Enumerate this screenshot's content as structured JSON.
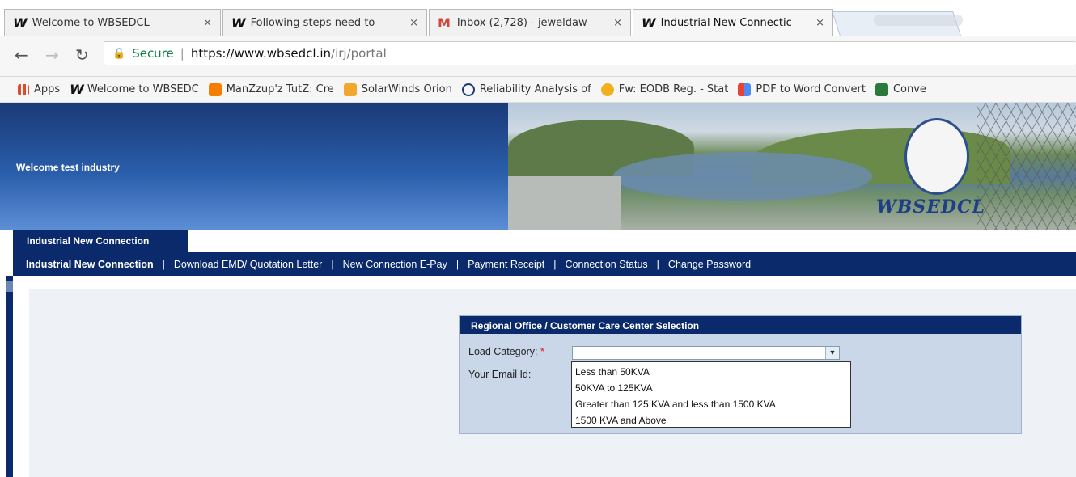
{
  "browser": {
    "tabs": [
      {
        "title": "Welcome to WBSEDCL",
        "icon": "wbsedcl-logo-icon"
      },
      {
        "title": "Following steps need to",
        "icon": "wbsedcl-logo-icon"
      },
      {
        "title": "Inbox (2,728) - jeweldaw",
        "icon": "gmail-icon"
      },
      {
        "title": "Industrial New Connectic",
        "icon": "wbsedcl-logo-icon"
      }
    ],
    "close_glyph": "×",
    "secure_label": "Secure",
    "url_host": "https://www.wbsedcl.in",
    "url_path": "/irj/portal",
    "bookmarks": [
      {
        "label": "Apps",
        "icon": "apps-grid-icon",
        "color": "#e04b2f"
      },
      {
        "label": "Welcome to WBSEDC",
        "icon": "wbsedcl-logo-icon",
        "color": "#111111"
      },
      {
        "label": "ManZzup'z TutZ: Cre",
        "icon": "blogger-icon",
        "color": "#f57d00"
      },
      {
        "label": "SolarWinds Orion",
        "icon": "solarwinds-icon",
        "color": "#f0a830"
      },
      {
        "label": "Reliability Analysis of",
        "icon": "scribd-icon",
        "color": "#1a3b78"
      },
      {
        "label": "Fw: EODB Reg. - Stat",
        "icon": "mail-icon",
        "color": "#f2b01e"
      },
      {
        "label": "PDF to Word Convert",
        "icon": "pdf-icon",
        "color": "#4c8bf5"
      },
      {
        "label": "Conve",
        "icon": "excel-icon",
        "color": "#2a7a3a"
      }
    ]
  },
  "banner": {
    "welcome": "Welcome test industry",
    "logo_text": "WBSEDCL"
  },
  "app": {
    "tab_label": "Industrial New Connection",
    "nav": [
      {
        "label": "Industrial New Connection",
        "active": true
      },
      {
        "label": "Download EMD/ Quotation Letter"
      },
      {
        "label": "New Connection E-Pay"
      },
      {
        "label": "Payment Receipt"
      },
      {
        "label": "Connection Status"
      },
      {
        "label": "Change Password"
      }
    ],
    "nav_separator": "|"
  },
  "form": {
    "title": "Regional Office / Customer Care Center Selection",
    "load_category_label": "Load Category:",
    "required_mark": "*",
    "email_label": "Your Email Id:",
    "load_category_value": "",
    "options": [
      "Less than 50KVA",
      "50KVA to 125KVA",
      "Greater than 125 KVA and less than 1500 KVA",
      "1500 KVA and Above"
    ]
  },
  "colors": {
    "nav_bg": "#0a2a6b",
    "panel_bg": "#c9d7e8",
    "secure_green": "#0b8043"
  }
}
